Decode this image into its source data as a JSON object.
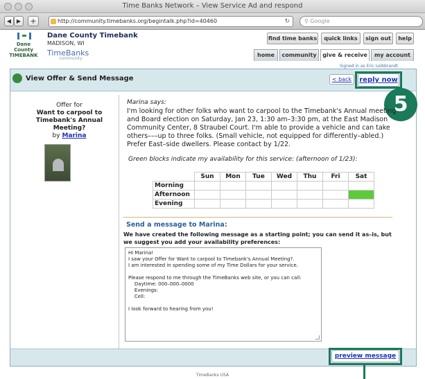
{
  "window": {
    "title": "Time Banks Network – View Service Ad and respond"
  },
  "toolbar": {
    "url": "http://community.timebanks.org/begintalk.php?id=40460",
    "search_placeholder": "Google",
    "back_icon": "left-arrow",
    "forward_icon": "right-arrow",
    "add_icon": "plus",
    "reload_icon": "reload"
  },
  "site": {
    "logo_text": "Dane County TIMEBANK",
    "name": "Dane County Timebank",
    "location": "MADISON, WI",
    "brand": "TimeBanks",
    "brand_sub": "community"
  },
  "header_buttons": [
    "find time banks",
    "quick links",
    "sign out",
    "help"
  ],
  "nav_tabs": [
    {
      "label": "home",
      "active": false
    },
    {
      "label": "community",
      "active": false
    },
    {
      "label": "give & receive",
      "active": true
    },
    {
      "label": "my account",
      "active": false
    }
  ],
  "signed_in": "Signed in as Eric Leibbrandt",
  "panel": {
    "title": "View Offer & Send Message",
    "back_label": "< back",
    "reply_label": "reply now",
    "step_badge": "5"
  },
  "offer": {
    "prefix": "Offer for",
    "title": "Want to carpool to Timebank's Annual Meeting?",
    "by": "by",
    "author": "Marina",
    "says": "Marina says:",
    "description": "I'm looking for other folks who want to carpool to the Timebank's Annual meeting and Board election on Saturday, Jan 23, 1:30 am–3:30 pm, at the East Madison Community Center, 8 Straubel Court. I'm able to provide a vehicle and can take others–––up to three folks. (Small vehicle, not equipped for differently–abled.) Prefer East–side dwellers. Please contact by 1/22.",
    "availability_note": "Green blocks indicate my availability for this service: (afternoon of 1/23):"
  },
  "availability": {
    "days": [
      "Sun",
      "Mon",
      "Tue",
      "Wed",
      "Thu",
      "Fri",
      "Sat"
    ],
    "rows": [
      {
        "label": "Morning",
        "available": [
          false,
          false,
          false,
          false,
          false,
          false,
          false
        ]
      },
      {
        "label": "Afternoon",
        "available": [
          false,
          false,
          false,
          false,
          false,
          false,
          true
        ]
      },
      {
        "label": "Evening",
        "available": [
          false,
          false,
          false,
          false,
          false,
          false,
          false
        ]
      }
    ],
    "available_color": "#5ccb3a"
  },
  "message": {
    "heading": "Send a message to Marina:",
    "intro": "We have created the following message as a starting point; you can send it as–is, but we suggest you add your availability preferences:",
    "lines": [
      "Hi Marina!",
      "I saw your Offer for Want to carpool to Timebank's Annual Meeting?.",
      "I am interested in spending some of my Time Dollars for your service.",
      "",
      "Please respond to me through the TimeBanks web site, or you can call:",
      "    Daytime: 000–000–0000",
      "    Evenings:",
      "    Cell:",
      "",
      "I look forward to hearing from you!"
    ]
  },
  "footer": {
    "preview_label": "preview message",
    "copyright": "TimeBanks USA"
  },
  "colors": {
    "callout": "#1a7a5a",
    "link": "#1a33b8",
    "panel_head": "#d7e8ed"
  }
}
